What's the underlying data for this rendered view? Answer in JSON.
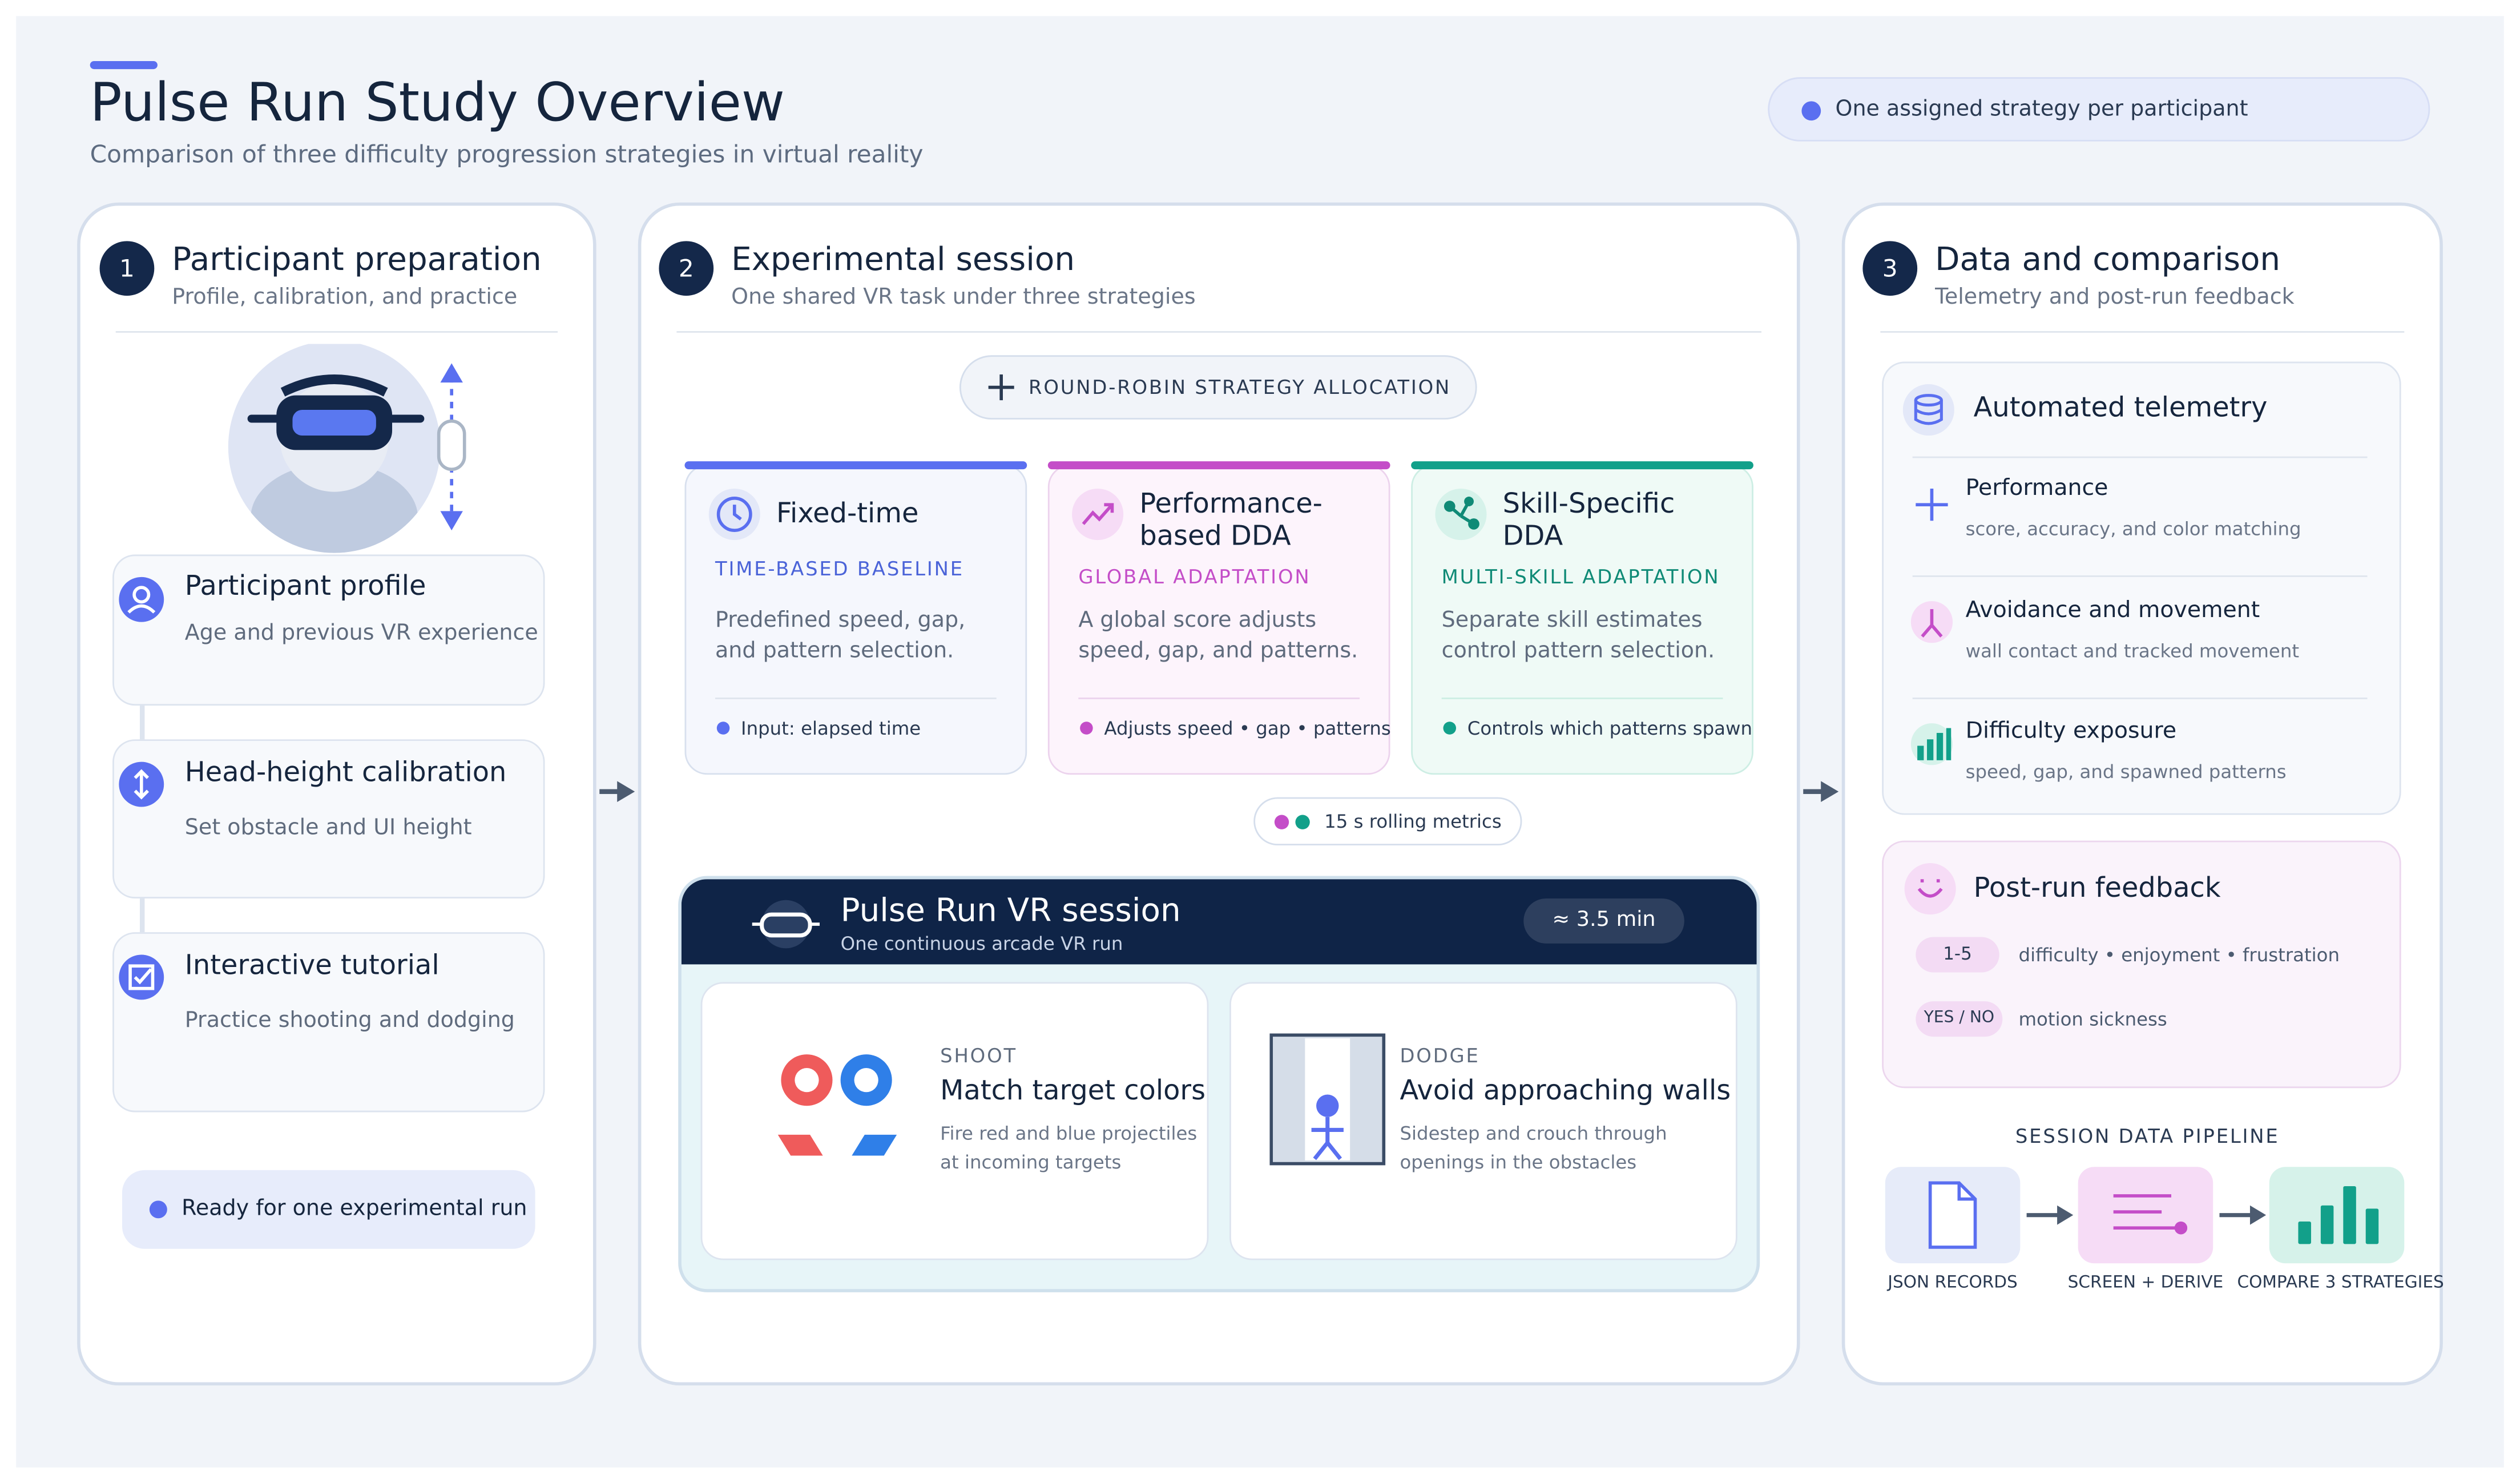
{
  "header": {
    "title": "Pulse Run Study Overview",
    "subtitle": "Comparison of three difficulty progression strategies in virtual reality",
    "badge": "One assigned strategy per participant"
  },
  "colors": {
    "accent": "#5a6ff0",
    "navy": "#14284a",
    "pink": "#c44dc8",
    "teal": "#12a08a"
  },
  "panel1": {
    "number": "1",
    "title": "Participant preparation",
    "subtitle": "Profile, calibration, and practice",
    "steps": [
      {
        "title": "Participant profile",
        "subtitle": "Age and previous VR experience",
        "icon": "user-icon"
      },
      {
        "title": "Head-height calibration",
        "subtitle": "Set obstacle and UI height",
        "icon": "vertical-arrows-icon"
      },
      {
        "title": "Interactive tutorial",
        "subtitle": "Practice shooting and dodging",
        "icon": "checkbox-icon"
      }
    ],
    "ready": "Ready for one experimental run"
  },
  "panel2": {
    "number": "2",
    "title": "Experimental session",
    "subtitle": "One shared VR task under three strategies",
    "allocation": "ROUND-ROBIN STRATEGY ALLOCATION",
    "strategies": [
      {
        "title": "Fixed-time",
        "tag": "TIME-BASED BASELINE",
        "desc1": "Predefined speed, gap,",
        "desc2": "and pattern selection.",
        "footer": "Input: elapsed time",
        "icon": "clock-icon"
      },
      {
        "title1": "Performance-",
        "title2": "based DDA",
        "tag": "GLOBAL ADAPTATION",
        "desc1": "A global score adjusts",
        "desc2": "speed, gap, and patterns.",
        "footer": "Adjusts speed • gap • patterns",
        "icon": "trend-up-icon"
      },
      {
        "title1": "Skill-Specific",
        "title2": "DDA",
        "tag": "MULTI-SKILL ADAPTATION",
        "desc1": "Separate skill estimates",
        "desc2": "control pattern selection.",
        "footer": "Controls which patterns spawn",
        "icon": "nodes-icon"
      }
    ],
    "rolling": "15 s rolling metrics",
    "session": {
      "title": "Pulse Run VR session",
      "subtitle": "One continuous arcade VR run",
      "duration": "≈ 3.5 min"
    },
    "tasks": [
      {
        "tag": "SHOOT",
        "title": "Match target colors",
        "desc1": "Fire red and blue projectiles",
        "desc2": "at incoming targets"
      },
      {
        "tag": "DODGE",
        "title": "Avoid approaching walls",
        "desc1": "Sidestep and crouch through",
        "desc2": "openings in the obstacles"
      }
    ]
  },
  "panel3": {
    "number": "3",
    "title": "Data and comparison",
    "subtitle": "Telemetry and post-run feedback",
    "telemetry": {
      "title": "Automated telemetry",
      "items": [
        {
          "title": "Performance",
          "subtitle": "score, accuracy, and color matching"
        },
        {
          "title": "Avoidance and movement",
          "subtitle": "wall contact and tracked movement"
        },
        {
          "title": "Difficulty exposure",
          "subtitle": "speed, gap, and spawned patterns"
        }
      ]
    },
    "feedback": {
      "title": "Post-run feedback",
      "items": [
        {
          "badge": "1-5",
          "text": "difficulty • enjoyment • frustration"
        },
        {
          "badge": "YES / NO",
          "text": "motion sickness"
        }
      ]
    },
    "pipeline": {
      "title": "SESSION DATA PIPELINE",
      "steps": [
        "JSON RECORDS",
        "SCREEN + DERIVE",
        "COMPARE 3 STRATEGIES"
      ]
    }
  }
}
